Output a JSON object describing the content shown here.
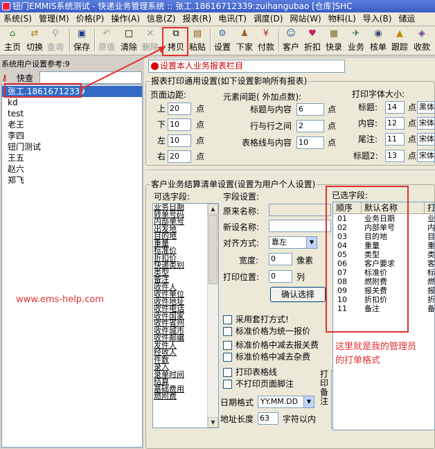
{
  "window": {
    "title": "钮门EMMIS系统测试 - 快递业务管理系统 :: 张工.18616712339:zuihangubao [仓库]SHC"
  },
  "menu": [
    "系统(S)",
    "管理(M)",
    "价格(P)",
    "操作(A)",
    "信息(Z)",
    "报表(R)",
    "电讯(T)",
    "调度(D)",
    "网站(W)",
    "物料(L)",
    "导入(B)",
    "储运"
  ],
  "toolbar": {
    "home": "主页",
    "switch": "切换",
    "query": "查询",
    "save": "保存",
    "original": "原值",
    "clear": "清除",
    "delete": "删除",
    "copy": "拷贝",
    "paste": "粘贴",
    "settings": "设置",
    "dispatch": "下家",
    "payment": "付款",
    "customer": "客户",
    "discount": "折扣",
    "express": "快录",
    "business": "业务",
    "approve": "核单",
    "track": "跟踪",
    "collect": "收款"
  },
  "left": {
    "header": "系统用户设置参考:9",
    "quick_label": "快查",
    "quick_value": "",
    "users": [
      "张工.18616712339",
      "kd",
      "test",
      "老王",
      "李四",
      "钮门测试",
      "王五",
      "赵六",
      "郑飞"
    ]
  },
  "right": {
    "title": "设置本人业务报表栏目",
    "print_group": "报表打印通用设置(如下设置影响所有报表)",
    "margin_label": "页面边距:",
    "margins": [
      {
        "label": "上",
        "value": "20",
        "unit": "点"
      },
      {
        "label": "下",
        "value": "10",
        "unit": "点"
      },
      {
        "label": "左",
        "value": "10",
        "unit": "点"
      },
      {
        "label": "右",
        "value": "20",
        "unit": "点"
      }
    ],
    "spacing_label": "元素间距( 外加点数):",
    "spacings": [
      {
        "label": "标题与内容",
        "value": "6",
        "unit": "点"
      },
      {
        "label": "行与行之间",
        "value": "2",
        "unit": "点"
      },
      {
        "label": "表格线与内容",
        "value": "10",
        "unit": "点"
      }
    ],
    "font_label": "打印字体大小:",
    "fonts": [
      {
        "label": "标题:",
        "value": "14",
        "unit": "点",
        "font": "黑体"
      },
      {
        "label": "内容:",
        "value": "12",
        "unit": "点",
        "font": "宋体"
      },
      {
        "label": "尾注:",
        "value": "11",
        "unit": "点",
        "font": "宋体"
      },
      {
        "label": "标题2:",
        "value": "13",
        "unit": "点",
        "font": "宋体"
      }
    ],
    "customer_group": "客户业务结算清单设置(设置为用户个人设置)",
    "optional_label": "可选字段:",
    "optional_fields": [
      "业务日期",
      "转单号码",
      "内部单号",
      "出发地",
      "目的地",
      "重量",
      "标准价",
      "折扣价",
      "快递类别",
      "类型",
      "备注",
      "收件人",
      "收件单位",
      "收件地址",
      "收件电话",
      "收件国家",
      "收件省州",
      "收件城市",
      "收件邮编",
      "发件人",
      "经收人",
      "件数",
      "录入",
      "录单时间",
      "结算",
      "基础费用",
      "燃附费"
    ],
    "field_settings_label": "字段设置:",
    "orig_name_label": "原来名称:",
    "orig_name_value": "",
    "new_name_label": "新设名称:",
    "new_name_value": "",
    "align_label": "对齐方式:",
    "align_value": "靠左",
    "width_label": "宽度:",
    "width_value": "0",
    "width_unit": "像素",
    "print_pos_label": "打印位置:",
    "print_pos_value": "0",
    "print_pos_unit": "列",
    "confirm_button": "确认选择",
    "checks": [
      {
        "label": "采用套打方式!",
        "checked": false
      },
      {
        "label": "标准价格为统一报价",
        "checked": false
      },
      {
        "label": "标准价格中减去报关费",
        "checked": false
      },
      {
        "label": "标准价格中减去杂费",
        "checked": false
      },
      {
        "label": "打印表格线",
        "checked": false
      },
      {
        "label": "不打印页面脚注",
        "checked": false
      }
    ],
    "date_format_label": "日期格式",
    "date_format_value": "YY.MM.DD",
    "addr_len_label": "地址长度",
    "addr_len_value": "63",
    "addr_len_unit": "字符以内",
    "print_note_label": "打印备注",
    "selected_label": "已选字段:",
    "grid_headers": [
      "顺序",
      "默认名称",
      "打"
    ],
    "selected_fields": [
      {
        "no": "01",
        "name": "业务日期",
        "p": "业"
      },
      {
        "no": "02",
        "name": "内部单号",
        "p": "内"
      },
      {
        "no": "03",
        "name": "目的地",
        "p": "目"
      },
      {
        "no": "04",
        "name": "重量",
        "p": "重"
      },
      {
        "no": "05",
        "name": "类型",
        "p": "类"
      },
      {
        "no": "06",
        "name": "客户要求",
        "p": "客"
      },
      {
        "no": "07",
        "name": "标准价",
        "p": "标"
      },
      {
        "no": "08",
        "name": "燃附费",
        "p": "燃"
      },
      {
        "no": "09",
        "name": "报关费",
        "p": "报"
      },
      {
        "no": "10",
        "name": "折扣价",
        "p": "折"
      },
      {
        "no": "11",
        "name": "备注",
        "p": "备"
      }
    ]
  },
  "annotations": {
    "website": "www.ems-help.com",
    "note_line1": "这里就是我的管理员",
    "note_line2": "的打单格式"
  },
  "colors": {
    "annotation": "#e03030",
    "selection": "#316ac5",
    "title_red": "#cc0000"
  }
}
